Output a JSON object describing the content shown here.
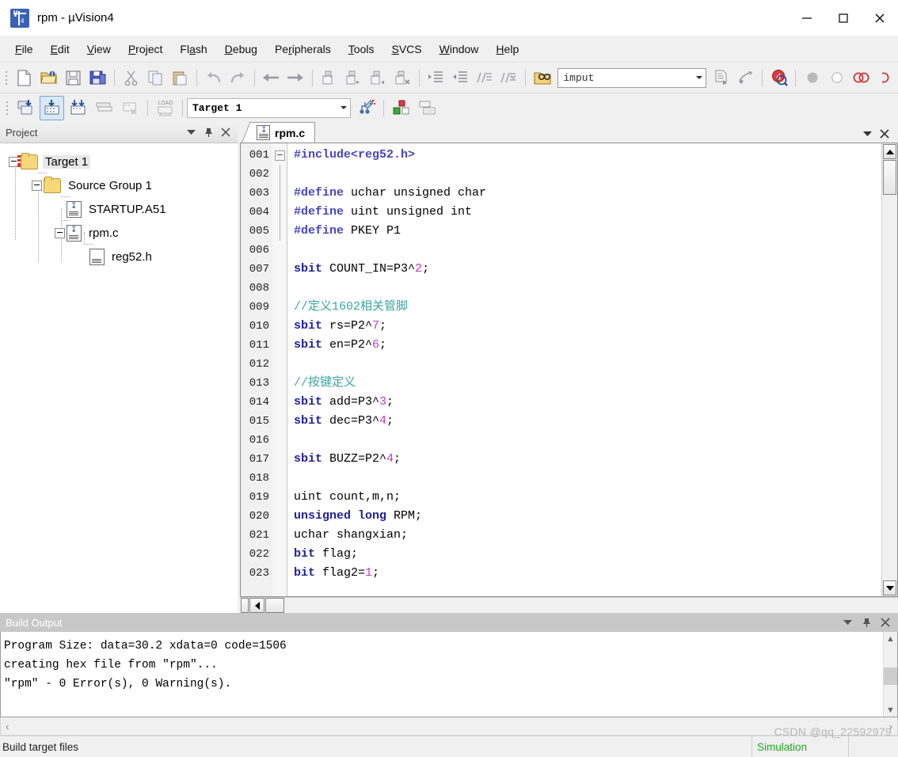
{
  "window": {
    "title": "rpm  - µVision4",
    "app_icon": "uvision-logo-icon",
    "controls": {
      "minimize": "minimize-icon",
      "maximize": "maximize-icon",
      "close": "close-icon"
    }
  },
  "menubar": {
    "items": [
      {
        "label": "File",
        "accel": "F"
      },
      {
        "label": "Edit",
        "accel": "E"
      },
      {
        "label": "View",
        "accel": "V"
      },
      {
        "label": "Project",
        "accel": "P"
      },
      {
        "label": "Flash",
        "accel": "a"
      },
      {
        "label": "Debug",
        "accel": "D"
      },
      {
        "label": "Peripherals",
        "accel": "r"
      },
      {
        "label": "Tools",
        "accel": "T"
      },
      {
        "label": "SVCS",
        "accel": "S"
      },
      {
        "label": "Window",
        "accel": "W"
      },
      {
        "label": "Help",
        "accel": "H"
      }
    ]
  },
  "toolbar_file": {
    "buttons": [
      {
        "name": "new-file-button"
      },
      {
        "name": "open-file-button"
      },
      {
        "name": "save-button"
      },
      {
        "name": "save-all-button"
      },
      {
        "name": "cut-button"
      },
      {
        "name": "copy-button"
      },
      {
        "name": "paste-button"
      },
      {
        "name": "undo-button"
      },
      {
        "name": "redo-button"
      },
      {
        "name": "navigate-back-button"
      },
      {
        "name": "navigate-forward-button"
      },
      {
        "name": "bookmark-toggle-button"
      },
      {
        "name": "bookmark-next-button"
      },
      {
        "name": "bookmark-prev-button"
      },
      {
        "name": "bookmark-clear-button"
      },
      {
        "name": "indent-button"
      },
      {
        "name": "outdent-button"
      },
      {
        "name": "comment-button"
      },
      {
        "name": "uncomment-button"
      },
      {
        "name": "find-in-files-button"
      }
    ],
    "search": {
      "value": "imput",
      "placeholder": ""
    },
    "after_search": [
      {
        "name": "insert-file-button"
      },
      {
        "name": "browse-symbols-button"
      },
      {
        "name": "debug-start-button"
      },
      {
        "name": "breakpoint-button"
      },
      {
        "name": "breakpoint-disable-button"
      },
      {
        "name": "breakpoint-kill-all-button"
      }
    ]
  },
  "toolbar_build": {
    "buttons": [
      {
        "name": "translate-file-button"
      },
      {
        "name": "build-target-button",
        "selected": true
      },
      {
        "name": "rebuild-all-button"
      },
      {
        "name": "batch-build-button"
      },
      {
        "name": "stop-build-button"
      },
      {
        "name": "download-button",
        "glyph": "LOAD"
      }
    ],
    "target_select": {
      "value": "Target 1"
    },
    "after_target": [
      {
        "name": "target-options-button"
      },
      {
        "name": "manage-components-button"
      },
      {
        "name": "manage-multi-project-button"
      }
    ]
  },
  "project_panel": {
    "title": "Project",
    "header_buttons": [
      "chevron-down-icon",
      "pin-icon",
      "close-icon"
    ],
    "tree": [
      {
        "label": "Target 1",
        "depth": 0,
        "type": "target-folder",
        "expander": "minus",
        "selected": true
      },
      {
        "label": "Source Group 1",
        "depth": 1,
        "type": "folder",
        "expander": "minus",
        "selected": false
      },
      {
        "label": "STARTUP.A51",
        "depth": 2,
        "type": "source-file",
        "expander": "none",
        "selected": false
      },
      {
        "label": "rpm.c",
        "depth": 2,
        "type": "source-file",
        "expander": "minus",
        "selected": false
      },
      {
        "label": "reg52.h",
        "depth": 3,
        "type": "header-file",
        "expander": "none",
        "selected": false
      }
    ]
  },
  "editor": {
    "header_buttons": [
      "chevron-down-icon",
      "close-icon"
    ],
    "tabs": [
      {
        "label": "rpm.c",
        "active": true,
        "icon": "source-file-icon"
      }
    ],
    "lines": [
      {
        "no": "001",
        "fold": "minus",
        "tokens": [
          {
            "t": "#include<reg52.h>",
            "c": "pp"
          }
        ]
      },
      {
        "no": "002",
        "fold": "bar",
        "tokens": []
      },
      {
        "no": "003",
        "fold": "bar",
        "tokens": [
          {
            "t": "#define",
            "c": "pp"
          },
          {
            "t": " uchar unsigned char",
            "c": "txt"
          }
        ]
      },
      {
        "no": "004",
        "fold": "bar",
        "tokens": [
          {
            "t": "#define",
            "c": "pp"
          },
          {
            "t": " uint unsigned int",
            "c": "txt"
          }
        ]
      },
      {
        "no": "005",
        "fold": "bar",
        "tokens": [
          {
            "t": "#define",
            "c": "pp"
          },
          {
            "t": " PKEY P1",
            "c": "txt"
          }
        ]
      },
      {
        "no": "006",
        "fold": "none",
        "tokens": []
      },
      {
        "no": "007",
        "fold": "none",
        "tokens": [
          {
            "t": "sbit",
            "c": "kw"
          },
          {
            "t": " COUNT_IN=P3^",
            "c": "txt"
          },
          {
            "t": "2",
            "c": "num"
          },
          {
            "t": ";",
            "c": "txt"
          }
        ]
      },
      {
        "no": "008",
        "fold": "none",
        "tokens": []
      },
      {
        "no": "009",
        "fold": "none",
        "tokens": [
          {
            "t": "//定义1602相关管脚",
            "c": "cm"
          }
        ]
      },
      {
        "no": "010",
        "fold": "none",
        "tokens": [
          {
            "t": "sbit",
            "c": "kw"
          },
          {
            "t": " rs=P2^",
            "c": "txt"
          },
          {
            "t": "7",
            "c": "num"
          },
          {
            "t": ";",
            "c": "txt"
          }
        ]
      },
      {
        "no": "011",
        "fold": "none",
        "tokens": [
          {
            "t": "sbit",
            "c": "kw"
          },
          {
            "t": " en=P2^",
            "c": "txt"
          },
          {
            "t": "6",
            "c": "num"
          },
          {
            "t": ";",
            "c": "txt"
          }
        ]
      },
      {
        "no": "012",
        "fold": "none",
        "tokens": []
      },
      {
        "no": "013",
        "fold": "none",
        "tokens": [
          {
            "t": "//按键定义",
            "c": "cm"
          }
        ]
      },
      {
        "no": "014",
        "fold": "none",
        "tokens": [
          {
            "t": "sbit",
            "c": "kw"
          },
          {
            "t": " add=P3^",
            "c": "txt"
          },
          {
            "t": "3",
            "c": "num"
          },
          {
            "t": ";",
            "c": "txt"
          }
        ]
      },
      {
        "no": "015",
        "fold": "none",
        "tokens": [
          {
            "t": "sbit",
            "c": "kw"
          },
          {
            "t": " dec=P3^",
            "c": "txt"
          },
          {
            "t": "4",
            "c": "num"
          },
          {
            "t": ";",
            "c": "txt"
          }
        ]
      },
      {
        "no": "016",
        "fold": "none",
        "tokens": []
      },
      {
        "no": "017",
        "fold": "none",
        "tokens": [
          {
            "t": "sbit",
            "c": "kw"
          },
          {
            "t": " BUZZ=P2^",
            "c": "txt"
          },
          {
            "t": "4",
            "c": "num"
          },
          {
            "t": ";",
            "c": "txt"
          }
        ]
      },
      {
        "no": "018",
        "fold": "none",
        "tokens": []
      },
      {
        "no": "019",
        "fold": "none",
        "tokens": [
          {
            "t": "uint count,m,n;",
            "c": "txt"
          }
        ]
      },
      {
        "no": "020",
        "fold": "none",
        "tokens": [
          {
            "t": "unsigned",
            "c": "kw"
          },
          {
            "t": " ",
            "c": "txt"
          },
          {
            "t": "long",
            "c": "kw"
          },
          {
            "t": " RPM;",
            "c": "txt"
          }
        ]
      },
      {
        "no": "021",
        "fold": "none",
        "tokens": [
          {
            "t": "uchar shangxian;",
            "c": "txt"
          }
        ]
      },
      {
        "no": "022",
        "fold": "none",
        "tokens": [
          {
            "t": "bit",
            "c": "kw"
          },
          {
            "t": " flag;",
            "c": "txt"
          }
        ]
      },
      {
        "no": "023",
        "fold": "none",
        "tokens": [
          {
            "t": "bit",
            "c": "kw"
          },
          {
            "t": " flag2=",
            "c": "txt"
          },
          {
            "t": "1",
            "c": "num"
          },
          {
            "t": ";",
            "c": "txt"
          }
        ]
      }
    ]
  },
  "build_output": {
    "title": "Build Output",
    "header_buttons": [
      "chevron-down-icon",
      "pin-icon",
      "close-icon"
    ],
    "lines": [
      "Program Size: data=30.2 xdata=0 code=1506",
      "creating hex file from \"rpm\"...",
      "\"rpm\" - 0 Error(s), 0 Warning(s)."
    ]
  },
  "status_bar": {
    "left": "Build target files",
    "simulation": "Simulation",
    "watermark": "CSDN @qq_22592979"
  },
  "colors": {
    "keyword": "#1f1f9e",
    "preprocessor": "#4646c8",
    "comment": "#3aa6a0",
    "number": "#c836c8",
    "simulation_green": "#22a822",
    "selected_toolbtn": "#d7e8f7"
  }
}
